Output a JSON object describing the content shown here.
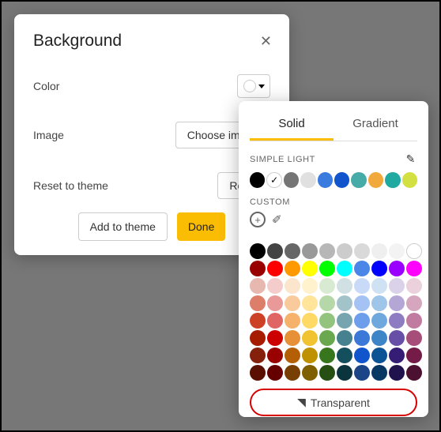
{
  "dialog": {
    "title": "Background",
    "color_label": "Color",
    "image_label": "Image",
    "choose_image_btn": "Choose image",
    "reset_label": "Reset to theme",
    "reset_btn": "Reset",
    "add_to_theme_btn": "Add to theme",
    "done_btn": "Done"
  },
  "picker": {
    "tabs": {
      "solid": "Solid",
      "gradient": "Gradient",
      "active": "solid"
    },
    "sections": {
      "simple_light": "SIMPLE LIGHT",
      "custom": "CUSTOM"
    },
    "simple_light_colors": [
      "#000000",
      "#ffffff",
      "#757575",
      "#e0e0e0",
      "#3a7be0",
      "#1155cc",
      "#46aaa6",
      "#f2a93b",
      "#1fa9a0",
      "#d3e041"
    ],
    "transparent_label": "Transparent"
  },
  "chart_data": null,
  "grid_colors": [
    [
      "#000000",
      "#434343",
      "#666666",
      "#999999",
      "#b7b7b7",
      "#cccccc",
      "#d9d9d9",
      "#efefef",
      "#f3f3f3",
      "#ffffff"
    ],
    [
      "#980000",
      "#ff0000",
      "#ff9900",
      "#ffff00",
      "#00ff00",
      "#00ffff",
      "#4a86e8",
      "#0000ff",
      "#9900ff",
      "#ff00ff"
    ],
    [
      "#e6b8af",
      "#f4cccc",
      "#fce5cd",
      "#fff2cc",
      "#d9ead3",
      "#d0e0e3",
      "#c9daf8",
      "#cfe2f3",
      "#d9d2e9",
      "#ead1dc"
    ],
    [
      "#dd7e6b",
      "#ea9999",
      "#f9cb9c",
      "#ffe599",
      "#b6d7a8",
      "#a2c4c9",
      "#a4c2f4",
      "#9fc5e8",
      "#b4a7d6",
      "#d5a6bd"
    ],
    [
      "#cc4125",
      "#e06666",
      "#f6b26b",
      "#ffd966",
      "#93c47d",
      "#76a5af",
      "#6d9eeb",
      "#6fa8dc",
      "#8e7cc3",
      "#c27ba0"
    ],
    [
      "#a61c00",
      "#cc0000",
      "#e69138",
      "#f1c232",
      "#6aa84f",
      "#45818e",
      "#3c78d8",
      "#3d85c6",
      "#674ea7",
      "#a64d79"
    ],
    [
      "#85200c",
      "#990000",
      "#b45f06",
      "#bf9000",
      "#38761d",
      "#134f5c",
      "#1155cc",
      "#0b5394",
      "#351c75",
      "#741b47"
    ],
    [
      "#5b0f00",
      "#660000",
      "#783f04",
      "#7f6000",
      "#274e13",
      "#0c343d",
      "#1c4587",
      "#073763",
      "#20124d",
      "#4c1130"
    ]
  ]
}
